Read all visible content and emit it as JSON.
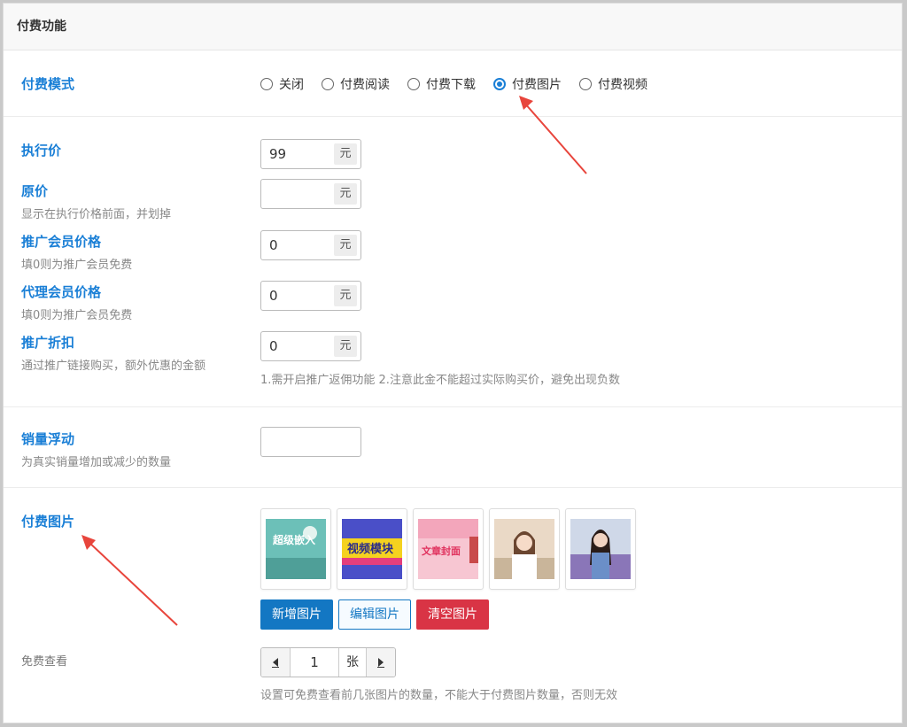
{
  "panel_title": "付费功能",
  "pay_mode": {
    "label": "付费模式",
    "options": [
      "关闭",
      "付费阅读",
      "付费下载",
      "付费图片",
      "付费视频"
    ],
    "selected": "付费图片"
  },
  "price": {
    "label": "执行价",
    "value": "99",
    "unit": "元"
  },
  "original_price": {
    "label": "原价",
    "desc": "显示在执行价格前面，并划掉",
    "value": "",
    "unit": "元"
  },
  "promo_member_price": {
    "label": "推广会员价格",
    "desc": "填0则为推广会员免费",
    "value": "0",
    "unit": "元"
  },
  "agent_member_price": {
    "label": "代理会员价格",
    "desc": "填0则为推广会员免费",
    "value": "0",
    "unit": "元"
  },
  "promo_discount": {
    "label": "推广折扣",
    "desc": "通过推广链接购买，额外优惠的金额",
    "value": "0",
    "unit": "元",
    "hint": "1.需开启推广返佣功能 2.注意此金不能超过实际购买价，避免出现负数"
  },
  "sales_float": {
    "label": "销量浮动",
    "desc": "为真实销量增加或减少的数量",
    "value": ""
  },
  "paid_images": {
    "label": "付费图片",
    "thumbnails": [
      {
        "name": "thumb-1",
        "text": "超级嵌入"
      },
      {
        "name": "thumb-2",
        "text": "视频模块"
      },
      {
        "name": "thumb-3",
        "text": "文章封面"
      },
      {
        "name": "thumb-4",
        "text": ""
      },
      {
        "name": "thumb-5",
        "text": ""
      }
    ],
    "add_label": "新增图片",
    "edit_label": "编辑图片",
    "clear_label": "清空图片"
  },
  "free_view": {
    "label": "免费查看",
    "value": "1",
    "unit": "张",
    "hint": "设置可免费查看前几张图片的数量，不能大于付费图片数量，否则无效"
  },
  "colors": {
    "accent": "#1a7fd6",
    "primary_button": "#1377c3",
    "danger_button": "#d93445",
    "arrow": "#e8453c"
  }
}
